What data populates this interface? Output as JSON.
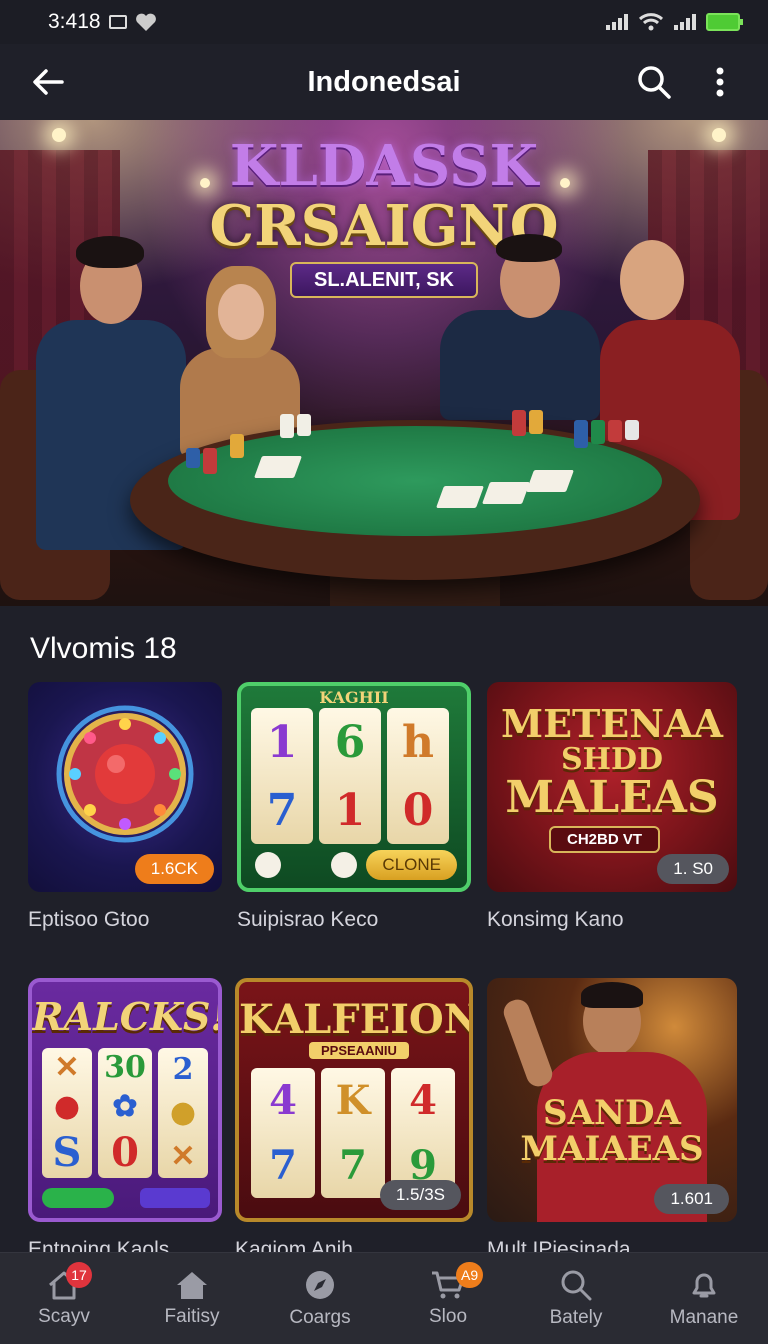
{
  "status": {
    "time": "3:418"
  },
  "app_bar": {
    "title": "Indonedsai"
  },
  "hero": {
    "title_line1": "KLDASSK",
    "title_line2": "CRSAIGNO",
    "ribbon": "SL.ALENIT, SK"
  },
  "section": {
    "title": "Vlvomis 18"
  },
  "games": [
    {
      "name": "Eptisoo  Gtoo",
      "badge": "1.6CK",
      "badge_color": "#ee7d1b"
    },
    {
      "name": "Suipisrao  Keco",
      "badge": "CLONE",
      "top_label": "KAGHII",
      "reel_symbols": [
        "1",
        "6",
        "h",
        "7",
        "1",
        "0"
      ]
    },
    {
      "name": "Konsimg  Kano",
      "badge": "1. S0",
      "art_line1": "METENAA",
      "art_line2": "SHDD",
      "art_line3": "MALEAS",
      "art_ribbon": "CH2BD VT"
    },
    {
      "name": "Entnoing  Kaols",
      "art_title": "RALCKS!",
      "reel_symbols": [
        "30",
        "2",
        "S",
        "0"
      ]
    },
    {
      "name": "Kaqiom  Anih",
      "badge": "1.5/3S",
      "art_title": "KALFEION",
      "art_sub": "PPSEAANIU",
      "reel_symbols": [
        "4",
        "K",
        "4",
        "7",
        "7",
        "9"
      ]
    },
    {
      "name": "Mult  IPiesinada",
      "badge": "1.601",
      "art_line1": "SANDA",
      "art_line2": "MAIAEAS"
    }
  ],
  "nav": [
    {
      "label": "Scayv",
      "icon": "home-icon",
      "badge": "17"
    },
    {
      "label": "Faitisy",
      "icon": "house-icon"
    },
    {
      "label": "Coargs",
      "icon": "compass-icon"
    },
    {
      "label": "Sloo",
      "icon": "cart-icon",
      "badge": "A9"
    },
    {
      "label": "Bately",
      "icon": "search-icon"
    },
    {
      "label": "Manane",
      "icon": "bell-icon"
    }
  ],
  "colors": {
    "background": "#1f2029",
    "accent_orange": "#ee7d1b",
    "badge_red": "#e0343d",
    "nav_bg": "#2a2b33"
  }
}
